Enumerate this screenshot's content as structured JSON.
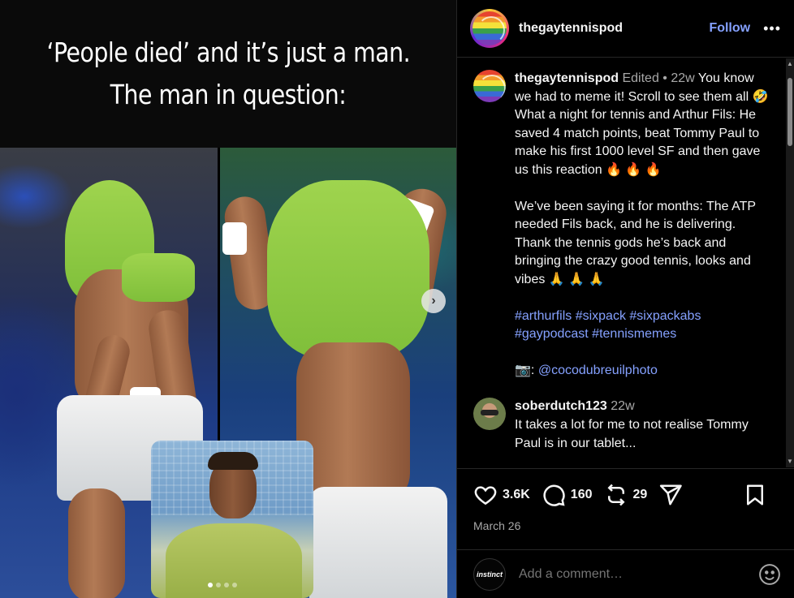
{
  "media": {
    "caption_line1": "‘People died’ and it’s just a man.",
    "caption_line2": "The man in question:",
    "next_icon": "chevron-right-icon",
    "carousel_dots": 4,
    "carousel_active": 1
  },
  "header": {
    "username": "thegaytennispod",
    "follow_label": "Follow",
    "more_icon": "more-horizontal-icon"
  },
  "post": {
    "author": "thegaytennispod",
    "edited": "Edited",
    "separator": "•",
    "age": "22w",
    "para1": "You know we had to meme it! Scroll to see them all 🤣 What a night for tennis and Arthur Fils: He saved 4 match points, beat Tommy Paul to make his first 1000 level SF and then gave us this reaction 🔥 🔥 🔥",
    "para2": "We’ve been saying it for months: The ATP needed Fils back, and he is delivering. Thank the tennis gods he’s back and bringing the crazy good tennis, looks and vibes 🙏 🙏 🙏",
    "hashtags": "#arthurfils #sixpack #sixpackabs #gaypodcast #tennismemes",
    "credit_emoji": "📷:",
    "credit_handle": "@cocodubreuilphoto"
  },
  "comment": {
    "author": "soberdutch123",
    "age": "22w",
    "text": "It takes a lot for me to not realise Tommy Paul is in our tablet..."
  },
  "actions": {
    "likes": "3.6K",
    "comments": "160",
    "reposts": "29",
    "date": "March 26"
  },
  "composer": {
    "avatar_text": "instinct",
    "placeholder": "Add a comment…"
  },
  "colors": {
    "link": "#85a1ff",
    "muted": "#a8a8a8",
    "background": "#000000"
  }
}
